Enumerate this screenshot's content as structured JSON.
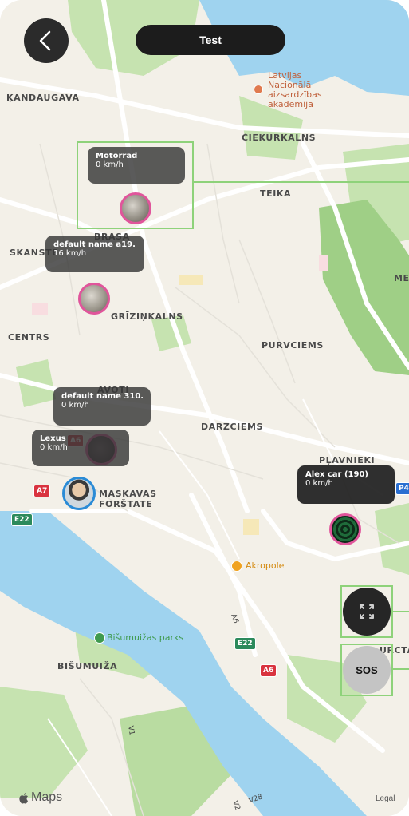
{
  "header": {
    "title": "Test"
  },
  "districts": [
    "ĶANDAUGAVA",
    "ČIEKURKALNS",
    "TEIKA",
    "BRASA",
    "SKANSTE",
    "GRĪZIŅKALNS",
    "CENTRS",
    "PURVCIEMS",
    "AVOTI",
    "DĀRZCIEMS",
    "PĻAVNIEKI",
    "MASKAVAS",
    "FORŠTATE",
    "BIŠUMUIŽA",
    "ME",
    "URCTAV"
  ],
  "pois": {
    "latvijas": [
      "Latvijas",
      "Nacionālā",
      "aizsardzības",
      "akadēmija"
    ],
    "akropole": "Akropole",
    "park": "Bišumuižas parks"
  },
  "roads": {
    "a7": "A7",
    "e22_left": "E22",
    "a6_top": "A6",
    "e22_bottom": "E22",
    "a6_bottom": "A6",
    "a6_diag": "A6",
    "v1": "V1",
    "v2": "V2",
    "v28": "V28",
    "p4": "P4"
  },
  "vehicles": [
    {
      "name": "Motorrad",
      "speed": "0 km/h"
    },
    {
      "name": "default name a19...",
      "speed": "16 km/h"
    },
    {
      "name": "default name 310...",
      "speed": "0 km/h"
    },
    {
      "name": "Lexus",
      "speed": "0 km/h"
    },
    {
      "name": "Alex car (190)",
      "speed": "0 km/h"
    }
  ],
  "controls": {
    "fullscreen_icon": "expand-icon",
    "sos_label": "SOS"
  },
  "footer": {
    "maps_logo": "Maps",
    "legal": "Legal"
  },
  "colors": {
    "accent_pink": "#e0559b",
    "highlight_green": "#8ed27a",
    "water": "#9fd3ef",
    "park": "#c6e3b0"
  }
}
